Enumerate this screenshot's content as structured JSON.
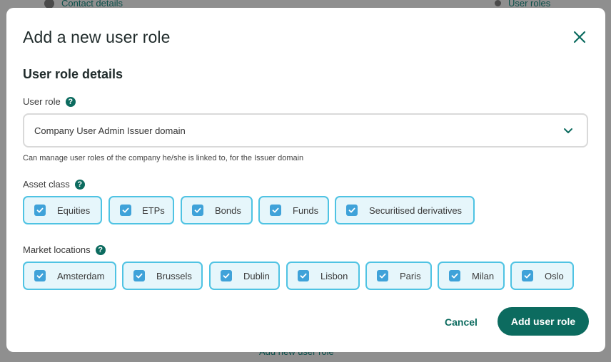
{
  "background": {
    "step_left_label": "Contact details",
    "step_right_label": "User roles",
    "bottom_link": "Add new user role"
  },
  "modal": {
    "title": "Add a new user role",
    "close_icon": "close-icon",
    "section_title": "User role details",
    "user_role": {
      "label": "User role",
      "value": "Company User Admin Issuer domain",
      "helper": "Can manage user roles of the company he/she is linked to, for the Issuer domain"
    },
    "asset_class": {
      "label": "Asset class",
      "options": [
        {
          "label": "Equities",
          "checked": true
        },
        {
          "label": "ETPs",
          "checked": true
        },
        {
          "label": "Bonds",
          "checked": true
        },
        {
          "label": "Funds",
          "checked": true
        },
        {
          "label": "Securitised derivatives",
          "checked": true
        }
      ]
    },
    "market_locations": {
      "label": "Market locations",
      "options": [
        {
          "label": "Amsterdam",
          "checked": true
        },
        {
          "label": "Brussels",
          "checked": true
        },
        {
          "label": "Dublin",
          "checked": true
        },
        {
          "label": "Lisbon",
          "checked": true
        },
        {
          "label": "Paris",
          "checked": true
        },
        {
          "label": "Milan",
          "checked": true
        },
        {
          "label": "Oslo",
          "checked": true
        }
      ]
    },
    "actions": {
      "cancel": "Cancel",
      "submit": "Add user role"
    }
  },
  "colors": {
    "brand": "#0c6b5f",
    "chip_border": "#4fc3e3",
    "chip_bg": "#e6f6fb",
    "checkbox": "#3fa2d9"
  }
}
